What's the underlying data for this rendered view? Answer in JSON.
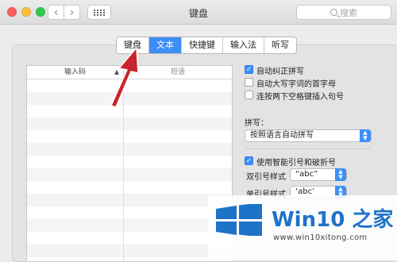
{
  "window": {
    "title": "键盘"
  },
  "search": {
    "placeholder": "搜索"
  },
  "tabs": [
    {
      "label": "键盘",
      "active": false
    },
    {
      "label": "文本",
      "active": true
    },
    {
      "label": "快捷键",
      "active": false
    },
    {
      "label": "输入法",
      "active": false
    },
    {
      "label": "听写",
      "active": false
    }
  ],
  "table": {
    "columns": [
      "输入码",
      "短语"
    ],
    "rows": []
  },
  "options": {
    "auto_correct": {
      "label": "自动纠正拼写",
      "checked": true
    },
    "auto_capitalize": {
      "label": "自动大写字词的首字母",
      "checked": false
    },
    "double_space_period": {
      "label": "连按两下空格键插入句号",
      "checked": false
    },
    "spelling_label": "拼写：",
    "spelling_value": "按照语言自动拼写",
    "smart_quotes": {
      "label": "使用智能引号和破折号",
      "checked": true
    },
    "double_quotes_label": "双引号样式",
    "double_quotes_value": "“abc”",
    "single_quotes_label": "单引号样式",
    "single_quotes_value": "‘abc’"
  },
  "watermark": {
    "brand": "Win10 之家",
    "url": "www.win10xitong.com"
  },
  "colors": {
    "accent": "#3d8ef7",
    "arrow": "#c8242b",
    "brand": "#1e73c8"
  }
}
